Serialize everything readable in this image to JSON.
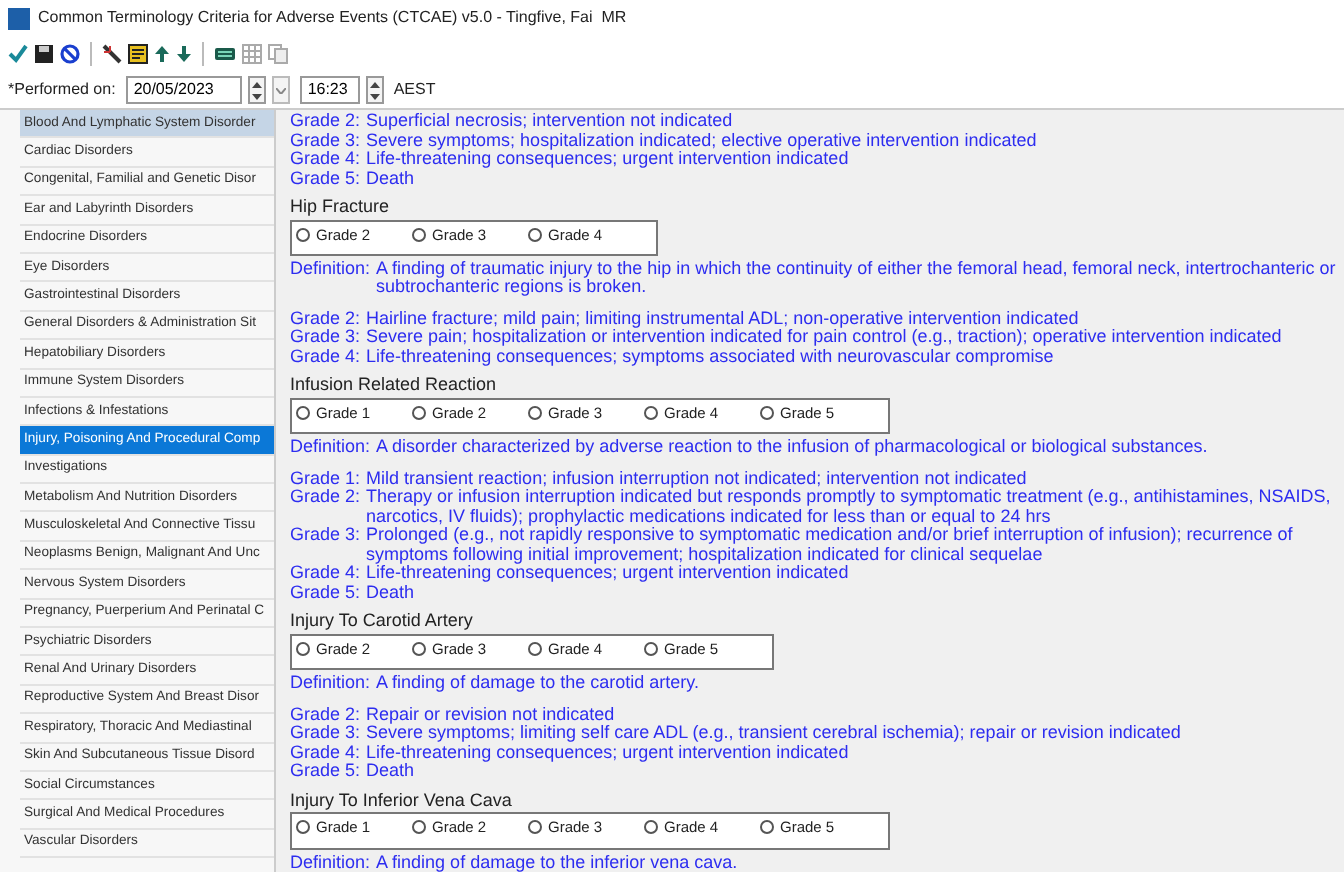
{
  "window": {
    "title": "Common Terminology Criteria for Adverse Events (CTCAE) v5.0 - Tingfive, Fai  MR"
  },
  "performed": {
    "label": "*Performed on:",
    "date": "20/05/2023",
    "time": "16:23",
    "timezone": "AEST"
  },
  "sidebar": {
    "items": [
      {
        "label": "Blood And Lymphatic System Disorder",
        "selected": false,
        "hover": true
      },
      {
        "label": "Cardiac Disorders",
        "selected": false,
        "hover": false
      },
      {
        "label": "Congenital, Familial and Genetic Disor",
        "selected": false,
        "hover": false
      },
      {
        "label": "Ear and Labyrinth Disorders",
        "selected": false,
        "hover": false
      },
      {
        "label": "Endocrine Disorders",
        "selected": false,
        "hover": false
      },
      {
        "label": "Eye Disorders",
        "selected": false,
        "hover": false
      },
      {
        "label": "Gastrointestinal Disorders",
        "selected": false,
        "hover": false
      },
      {
        "label": "General Disorders & Administration Sit",
        "selected": false,
        "hover": false
      },
      {
        "label": "Hepatobiliary Disorders",
        "selected": false,
        "hover": false
      },
      {
        "label": "Immune System Disorders",
        "selected": false,
        "hover": false
      },
      {
        "label": "Infections & Infestations",
        "selected": false,
        "hover": false
      },
      {
        "label": "Injury, Poisoning And Procedural Comp",
        "selected": true,
        "hover": false
      },
      {
        "label": "Investigations",
        "selected": false,
        "hover": false
      },
      {
        "label": "Metabolism And Nutrition Disorders",
        "selected": false,
        "hover": false
      },
      {
        "label": "Musculoskeletal And Connective Tissu",
        "selected": false,
        "hover": false
      },
      {
        "label": "Neoplasms Benign, Malignant And Unc",
        "selected": false,
        "hover": false
      },
      {
        "label": "Nervous System Disorders",
        "selected": false,
        "hover": false
      },
      {
        "label": "Pregnancy, Puerperium And Perinatal C",
        "selected": false,
        "hover": false
      },
      {
        "label": "Psychiatric Disorders",
        "selected": false,
        "hover": false
      },
      {
        "label": "Renal And Urinary Disorders",
        "selected": false,
        "hover": false
      },
      {
        "label": "Reproductive System And Breast Disor",
        "selected": false,
        "hover": false
      },
      {
        "label": "Respiratory, Thoracic And Mediastinal",
        "selected": false,
        "hover": false
      },
      {
        "label": "Skin And Subcutaneous Tissue Disord",
        "selected": false,
        "hover": false
      },
      {
        "label": "Social Circumstances",
        "selected": false,
        "hover": false
      },
      {
        "label": "Surgical And Medical Procedures",
        "selected": false,
        "hover": false
      },
      {
        "label": "Vascular Disorders",
        "selected": false,
        "hover": false
      }
    ]
  },
  "content": {
    "leading_grades": [
      {
        "grade": "Grade 2:",
        "text": "Superficial necrosis; intervention not indicated"
      },
      {
        "grade": "Grade 3:",
        "text": "Severe symptoms; hospitalization indicated; elective operative intervention indicated"
      },
      {
        "grade": "Grade 4:",
        "text": "Life-threatening consequences; urgent intervention indicated"
      },
      {
        "grade": "Grade 5:",
        "text": "Death"
      }
    ],
    "sections": [
      {
        "title": "Hip Fracture",
        "options": [
          {
            "label": "Grade 2",
            "selected": false
          },
          {
            "label": "Grade 3",
            "selected": false
          },
          {
            "label": "Grade 4",
            "selected": false
          }
        ],
        "definition": {
          "label": "Definition:",
          "text": "A finding of traumatic injury to the hip in which the continuity of either the femoral head, femoral neck, intertrochanteric or subtrochanteric regions is broken."
        },
        "grades": [
          {
            "grade": "Grade 2:",
            "text": "Hairline fracture; mild pain; limiting instrumental ADL; non-operative intervention indicated"
          },
          {
            "grade": "Grade 3:",
            "text": "Severe pain; hospitalization or intervention indicated for pain control (e.g., traction); operative intervention indicated"
          },
          {
            "grade": "Grade 4:",
            "text": "Life-threatening consequences; symptoms associated with neurovascular compromise"
          }
        ]
      },
      {
        "title": "Infusion Related Reaction",
        "options": [
          {
            "label": "Grade 1",
            "selected": false
          },
          {
            "label": "Grade 2",
            "selected": false
          },
          {
            "label": "Grade 3",
            "selected": false
          },
          {
            "label": "Grade 4",
            "selected": false
          },
          {
            "label": "Grade 5",
            "selected": false
          }
        ],
        "definition": {
          "label": "Definition:",
          "text": "A disorder characterized by adverse reaction to the infusion of pharmacological or biological substances."
        },
        "grades": [
          {
            "grade": "Grade 1:",
            "text": "Mild transient reaction; infusion interruption not indicated; intervention not indicated"
          },
          {
            "grade": "Grade 2:",
            "text": "Therapy or infusion interruption indicated but responds promptly to symptomatic treatment (e.g., antihistamines, NSAIDS, narcotics, IV fluids); prophylactic medications indicated for less than or equal to 24 hrs"
          },
          {
            "grade": "Grade 3:",
            "text": "Prolonged (e.g., not rapidly responsive to symptomatic medication and/or brief interruption of infusion); recurrence of symptoms following initial improvement; hospitalization indicated for clinical sequelae"
          },
          {
            "grade": "Grade 4:",
            "text": "Life-threatening consequences; urgent intervention indicated"
          },
          {
            "grade": "Grade 5:",
            "text": "Death"
          }
        ]
      },
      {
        "title": "Injury To Carotid Artery",
        "options": [
          {
            "label": "Grade 2",
            "selected": false
          },
          {
            "label": "Grade 3",
            "selected": false
          },
          {
            "label": "Grade 4",
            "selected": false
          },
          {
            "label": "Grade 5",
            "selected": false
          }
        ],
        "definition": {
          "label": "Definition:",
          "text": "A finding of damage to the carotid artery."
        },
        "grades": [
          {
            "grade": "Grade 2:",
            "text": "Repair or revision not indicated"
          },
          {
            "grade": "Grade 3:",
            "text": "Severe symptoms; limiting self care ADL (e.g., transient cerebral ischemia); repair or revision indicated"
          },
          {
            "grade": "Grade 4:",
            "text": "Life-threatening consequences; urgent intervention indicated"
          },
          {
            "grade": "Grade 5:",
            "text": "Death"
          }
        ]
      },
      {
        "title": "Injury To Inferior Vena Cava",
        "options": [
          {
            "label": "Grade 1",
            "selected": false
          },
          {
            "label": "Grade 2",
            "selected": false
          },
          {
            "label": "Grade 3",
            "selected": false
          },
          {
            "label": "Grade 4",
            "selected": false
          },
          {
            "label": "Grade 5",
            "selected": false
          }
        ],
        "definition": {
          "label": "Definition:",
          "text": "A finding of damage to the inferior vena cava."
        }
      }
    ]
  }
}
